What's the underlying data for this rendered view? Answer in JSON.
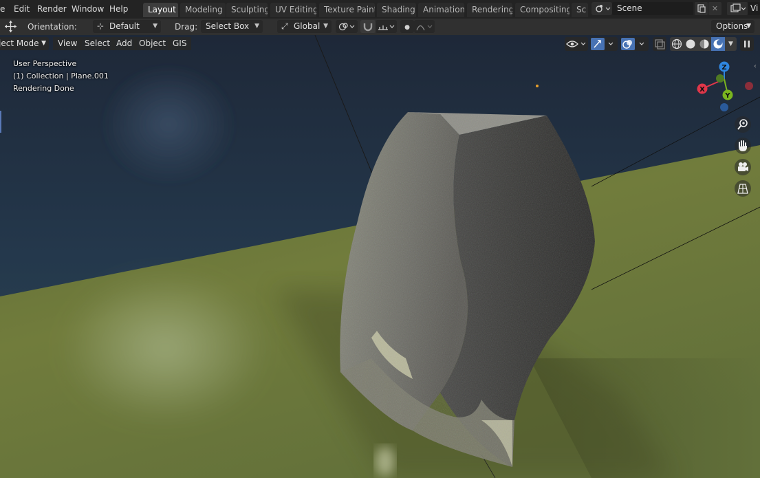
{
  "topbar": {
    "menus": [
      "e",
      "Edit",
      "Render",
      "Window",
      "Help"
    ],
    "workspaces": [
      "Layout",
      "Modeling",
      "Sculpting",
      "UV Editing",
      "Texture Paint",
      "Shading",
      "Animation",
      "Rendering",
      "Compositing",
      "Sc"
    ],
    "active_workspace": "Layout",
    "scene_name": "Scene",
    "view_layer_label": "Vi"
  },
  "toolheader": {
    "orientation_label": "Orientation:",
    "orientation_value": "Default",
    "drag_label": "Drag:",
    "drag_value": "Select Box",
    "transform_orientation": "Global",
    "options_label": "Options"
  },
  "viewport_header": {
    "mode": "ject Mode",
    "menus": [
      "View",
      "Select",
      "Add",
      "Object",
      "GIS"
    ]
  },
  "overlay": {
    "view_name": "User Perspective",
    "collection_info": "(1) Collection | Plane.001",
    "status": "Rendering Done"
  },
  "gizmo": {
    "x_label": "X",
    "y_label": "Y",
    "z_label": "Z",
    "x_color": "#e0374a",
    "y_color": "#7ab51f",
    "z_color": "#2f86e0"
  },
  "icons": {
    "move_tool": "move-arrows-icon",
    "zoom": "zoom-icon",
    "pan": "hand-icon",
    "camera": "camera-icon",
    "ortho": "grid-icon"
  },
  "colors": {
    "accent": "#4772b3",
    "floor": "#6f7a3a",
    "sky": "#26344a"
  }
}
